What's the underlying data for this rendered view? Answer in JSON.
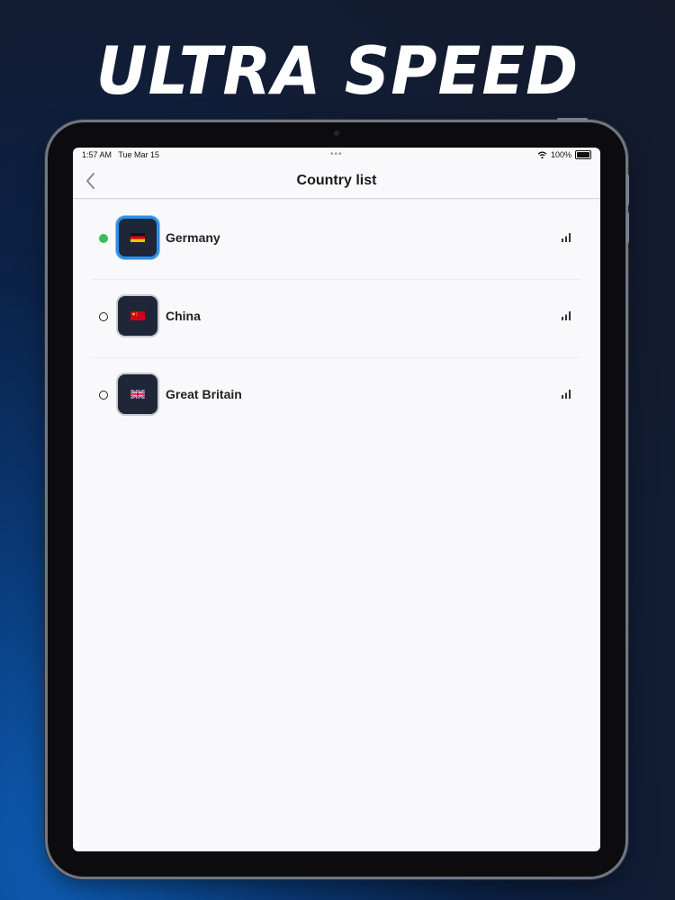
{
  "headline": "ULTRA SPEED",
  "status_bar": {
    "time": "1:57 AM",
    "date": "Tue Mar 15",
    "dots": "•••",
    "battery": "100%"
  },
  "nav": {
    "title": "Country list"
  },
  "countries": [
    {
      "name": "Germany",
      "selected": true
    },
    {
      "name": "China",
      "selected": false
    },
    {
      "name": "Great Britain",
      "selected": false
    }
  ],
  "colors": {
    "selected_dot": "#3dbb5d",
    "active_border": "#2d8fe6",
    "flag_tile": "#1f2638"
  },
  "icons": {
    "back": "chevron-left-icon",
    "signal": "signal-bars-icon",
    "wifi": "wifi-icon",
    "battery": "battery-icon"
  }
}
